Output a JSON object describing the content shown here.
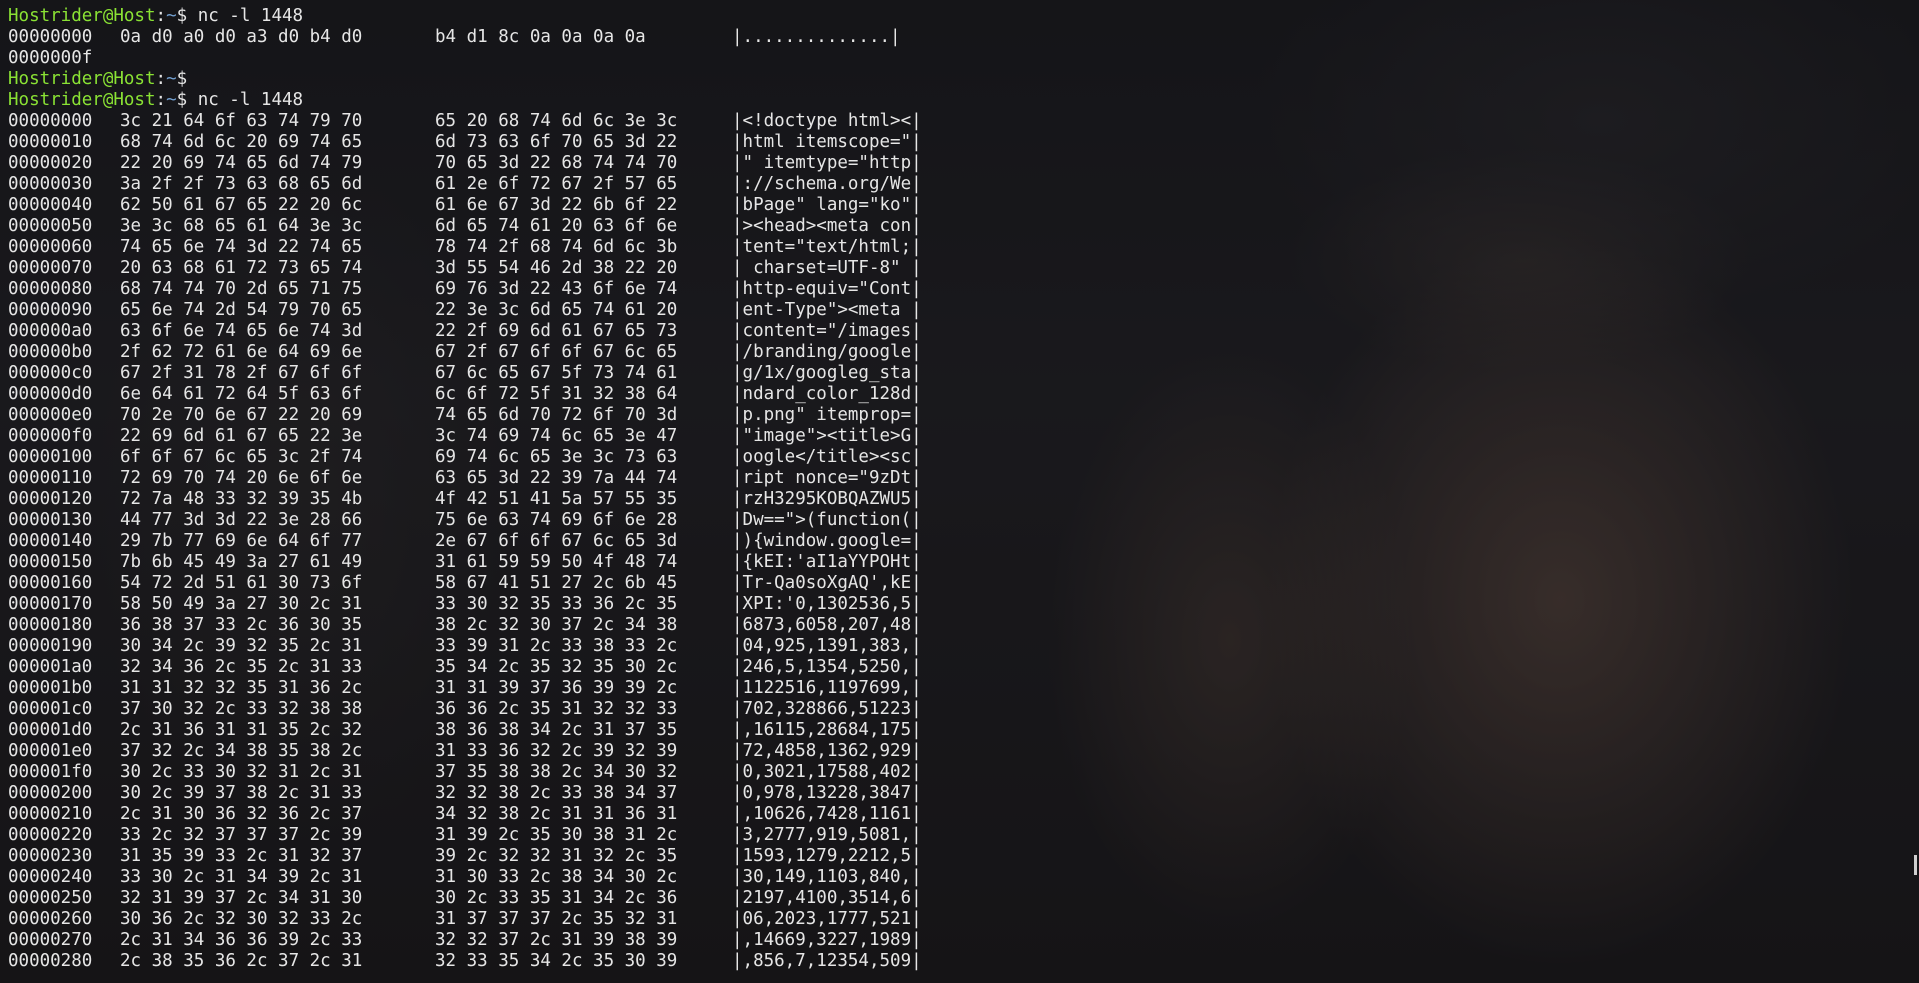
{
  "terminal": {
    "prompt": {
      "user_host": "Hostrider@Host",
      "path": "~",
      "symbol": "$"
    },
    "lines": [
      {
        "kind": "prompt",
        "cmd": "nc -l 1448"
      },
      {
        "kind": "hex",
        "offset": "00000000",
        "g1": "0a d0 a0 d0 a3 d0 b4 d0",
        "g2": "b4 d1 8c 0a 0a 0a 0a",
        "ascii": "|..............|"
      },
      {
        "kind": "text",
        "text": "0000000f"
      },
      {
        "kind": "prompt",
        "cmd": ""
      },
      {
        "kind": "prompt",
        "cmd": "nc -l 1448"
      },
      {
        "kind": "hex",
        "offset": "00000000",
        "g1": "3c 21 64 6f 63 74 79 70",
        "g2": "65 20 68 74 6d 6c 3e 3c",
        "ascii": "|<!doctype html><|"
      },
      {
        "kind": "hex",
        "offset": "00000010",
        "g1": "68 74 6d 6c 20 69 74 65",
        "g2": "6d 73 63 6f 70 65 3d 22",
        "ascii": "|html itemscope=\"|"
      },
      {
        "kind": "hex",
        "offset": "00000020",
        "g1": "22 20 69 74 65 6d 74 79",
        "g2": "70 65 3d 22 68 74 74 70",
        "ascii": "|\" itemtype=\"http|"
      },
      {
        "kind": "hex",
        "offset": "00000030",
        "g1": "3a 2f 2f 73 63 68 65 6d",
        "g2": "61 2e 6f 72 67 2f 57 65",
        "ascii": "|://schema.org/We|"
      },
      {
        "kind": "hex",
        "offset": "00000040",
        "g1": "62 50 61 67 65 22 20 6c",
        "g2": "61 6e 67 3d 22 6b 6f 22",
        "ascii": "|bPage\" lang=\"ko\"|"
      },
      {
        "kind": "hex",
        "offset": "00000050",
        "g1": "3e 3c 68 65 61 64 3e 3c",
        "g2": "6d 65 74 61 20 63 6f 6e",
        "ascii": "|><head><meta con|"
      },
      {
        "kind": "hex",
        "offset": "00000060",
        "g1": "74 65 6e 74 3d 22 74 65",
        "g2": "78 74 2f 68 74 6d 6c 3b",
        "ascii": "|tent=\"text/html;|"
      },
      {
        "kind": "hex",
        "offset": "00000070",
        "g1": "20 63 68 61 72 73 65 74",
        "g2": "3d 55 54 46 2d 38 22 20",
        "ascii": "| charset=UTF-8\" |"
      },
      {
        "kind": "hex",
        "offset": "00000080",
        "g1": "68 74 74 70 2d 65 71 75",
        "g2": "69 76 3d 22 43 6f 6e 74",
        "ascii": "|http-equiv=\"Cont|"
      },
      {
        "kind": "hex",
        "offset": "00000090",
        "g1": "65 6e 74 2d 54 79 70 65",
        "g2": "22 3e 3c 6d 65 74 61 20",
        "ascii": "|ent-Type\"><meta |"
      },
      {
        "kind": "hex",
        "offset": "000000a0",
        "g1": "63 6f 6e 74 65 6e 74 3d",
        "g2": "22 2f 69 6d 61 67 65 73",
        "ascii": "|content=\"/images|"
      },
      {
        "kind": "hex",
        "offset": "000000b0",
        "g1": "2f 62 72 61 6e 64 69 6e",
        "g2": "67 2f 67 6f 6f 67 6c 65",
        "ascii": "|/branding/google|"
      },
      {
        "kind": "hex",
        "offset": "000000c0",
        "g1": "67 2f 31 78 2f 67 6f 6f",
        "g2": "67 6c 65 67 5f 73 74 61",
        "ascii": "|g/1x/googleg_sta|"
      },
      {
        "kind": "hex",
        "offset": "000000d0",
        "g1": "6e 64 61 72 64 5f 63 6f",
        "g2": "6c 6f 72 5f 31 32 38 64",
        "ascii": "|ndard_color_128d|"
      },
      {
        "kind": "hex",
        "offset": "000000e0",
        "g1": "70 2e 70 6e 67 22 20 69",
        "g2": "74 65 6d 70 72 6f 70 3d",
        "ascii": "|p.png\" itemprop=|"
      },
      {
        "kind": "hex",
        "offset": "000000f0",
        "g1": "22 69 6d 61 67 65 22 3e",
        "g2": "3c 74 69 74 6c 65 3e 47",
        "ascii": "|\"image\"><title>G|"
      },
      {
        "kind": "hex",
        "offset": "00000100",
        "g1": "6f 6f 67 6c 65 3c 2f 74",
        "g2": "69 74 6c 65 3e 3c 73 63",
        "ascii": "|oogle</title><sc|"
      },
      {
        "kind": "hex",
        "offset": "00000110",
        "g1": "72 69 70 74 20 6e 6f 6e",
        "g2": "63 65 3d 22 39 7a 44 74",
        "ascii": "|ript nonce=\"9zDt|"
      },
      {
        "kind": "hex",
        "offset": "00000120",
        "g1": "72 7a 48 33 32 39 35 4b",
        "g2": "4f 42 51 41 5a 57 55 35",
        "ascii": "|rzH3295KOBQAZWU5|"
      },
      {
        "kind": "hex",
        "offset": "00000130",
        "g1": "44 77 3d 3d 22 3e 28 66",
        "g2": "75 6e 63 74 69 6f 6e 28",
        "ascii": "|Dw==\">(function(|"
      },
      {
        "kind": "hex",
        "offset": "00000140",
        "g1": "29 7b 77 69 6e 64 6f 77",
        "g2": "2e 67 6f 6f 67 6c 65 3d",
        "ascii": "|){window.google=|"
      },
      {
        "kind": "hex",
        "offset": "00000150",
        "g1": "7b 6b 45 49 3a 27 61 49",
        "g2": "31 61 59 59 50 4f 48 74",
        "ascii": "|{kEI:'aI1aYYPOHt|"
      },
      {
        "kind": "hex",
        "offset": "00000160",
        "g1": "54 72 2d 51 61 30 73 6f",
        "g2": "58 67 41 51 27 2c 6b 45",
        "ascii": "|Tr-Qa0soXgAQ',kE|"
      },
      {
        "kind": "hex",
        "offset": "00000170",
        "g1": "58 50 49 3a 27 30 2c 31",
        "g2": "33 30 32 35 33 36 2c 35",
        "ascii": "|XPI:'0,1302536,5|"
      },
      {
        "kind": "hex",
        "offset": "00000180",
        "g1": "36 38 37 33 2c 36 30 35",
        "g2": "38 2c 32 30 37 2c 34 38",
        "ascii": "|6873,6058,207,48|"
      },
      {
        "kind": "hex",
        "offset": "00000190",
        "g1": "30 34 2c 39 32 35 2c 31",
        "g2": "33 39 31 2c 33 38 33 2c",
        "ascii": "|04,925,1391,383,|"
      },
      {
        "kind": "hex",
        "offset": "000001a0",
        "g1": "32 34 36 2c 35 2c 31 33",
        "g2": "35 34 2c 35 32 35 30 2c",
        "ascii": "|246,5,1354,5250,|"
      },
      {
        "kind": "hex",
        "offset": "000001b0",
        "g1": "31 31 32 32 35 31 36 2c",
        "g2": "31 31 39 37 36 39 39 2c",
        "ascii": "|1122516,1197699,|"
      },
      {
        "kind": "hex",
        "offset": "000001c0",
        "g1": "37 30 32 2c 33 32 38 38",
        "g2": "36 36 2c 35 31 32 32 33",
        "ascii": "|702,328866,51223|"
      },
      {
        "kind": "hex",
        "offset": "000001d0",
        "g1": "2c 31 36 31 31 35 2c 32",
        "g2": "38 36 38 34 2c 31 37 35",
        "ascii": "|,16115,28684,175|"
      },
      {
        "kind": "hex",
        "offset": "000001e0",
        "g1": "37 32 2c 34 38 35 38 2c",
        "g2": "31 33 36 32 2c 39 32 39",
        "ascii": "|72,4858,1362,929|"
      },
      {
        "kind": "hex",
        "offset": "000001f0",
        "g1": "30 2c 33 30 32 31 2c 31",
        "g2": "37 35 38 38 2c 34 30 32",
        "ascii": "|0,3021,17588,402|"
      },
      {
        "kind": "hex",
        "offset": "00000200",
        "g1": "30 2c 39 37 38 2c 31 33",
        "g2": "32 32 38 2c 33 38 34 37",
        "ascii": "|0,978,13228,3847|"
      },
      {
        "kind": "hex",
        "offset": "00000210",
        "g1": "2c 31 30 36 32 36 2c 37",
        "g2": "34 32 38 2c 31 31 36 31",
        "ascii": "|,10626,7428,1161|"
      },
      {
        "kind": "hex",
        "offset": "00000220",
        "g1": "33 2c 32 37 37 37 2c 39",
        "g2": "31 39 2c 35 30 38 31 2c",
        "ascii": "|3,2777,919,5081,|"
      },
      {
        "kind": "hex",
        "offset": "00000230",
        "g1": "31 35 39 33 2c 31 32 37",
        "g2": "39 2c 32 32 31 32 2c 35",
        "ascii": "|1593,1279,2212,5|"
      },
      {
        "kind": "hex",
        "offset": "00000240",
        "g1": "33 30 2c 31 34 39 2c 31",
        "g2": "31 30 33 2c 38 34 30 2c",
        "ascii": "|30,149,1103,840,|"
      },
      {
        "kind": "hex",
        "offset": "00000250",
        "g1": "32 31 39 37 2c 34 31 30",
        "g2": "30 2c 33 35 31 34 2c 36",
        "ascii": "|2197,4100,3514,6|"
      },
      {
        "kind": "hex",
        "offset": "00000260",
        "g1": "30 36 2c 32 30 32 33 2c",
        "g2": "31 37 37 37 2c 35 32 31",
        "ascii": "|06,2023,1777,521|"
      },
      {
        "kind": "hex",
        "offset": "00000270",
        "g1": "2c 31 34 36 36 39 2c 33",
        "g2": "32 32 37 2c 31 39 38 39",
        "ascii": "|,14669,3227,1989|"
      },
      {
        "kind": "hex",
        "offset": "00000280",
        "g1": "2c 38 35 36 2c 37 2c 31",
        "g2": "32 33 35 34 2c 35 30 39",
        "ascii": "|,856,7,12354,509|"
      }
    ]
  }
}
